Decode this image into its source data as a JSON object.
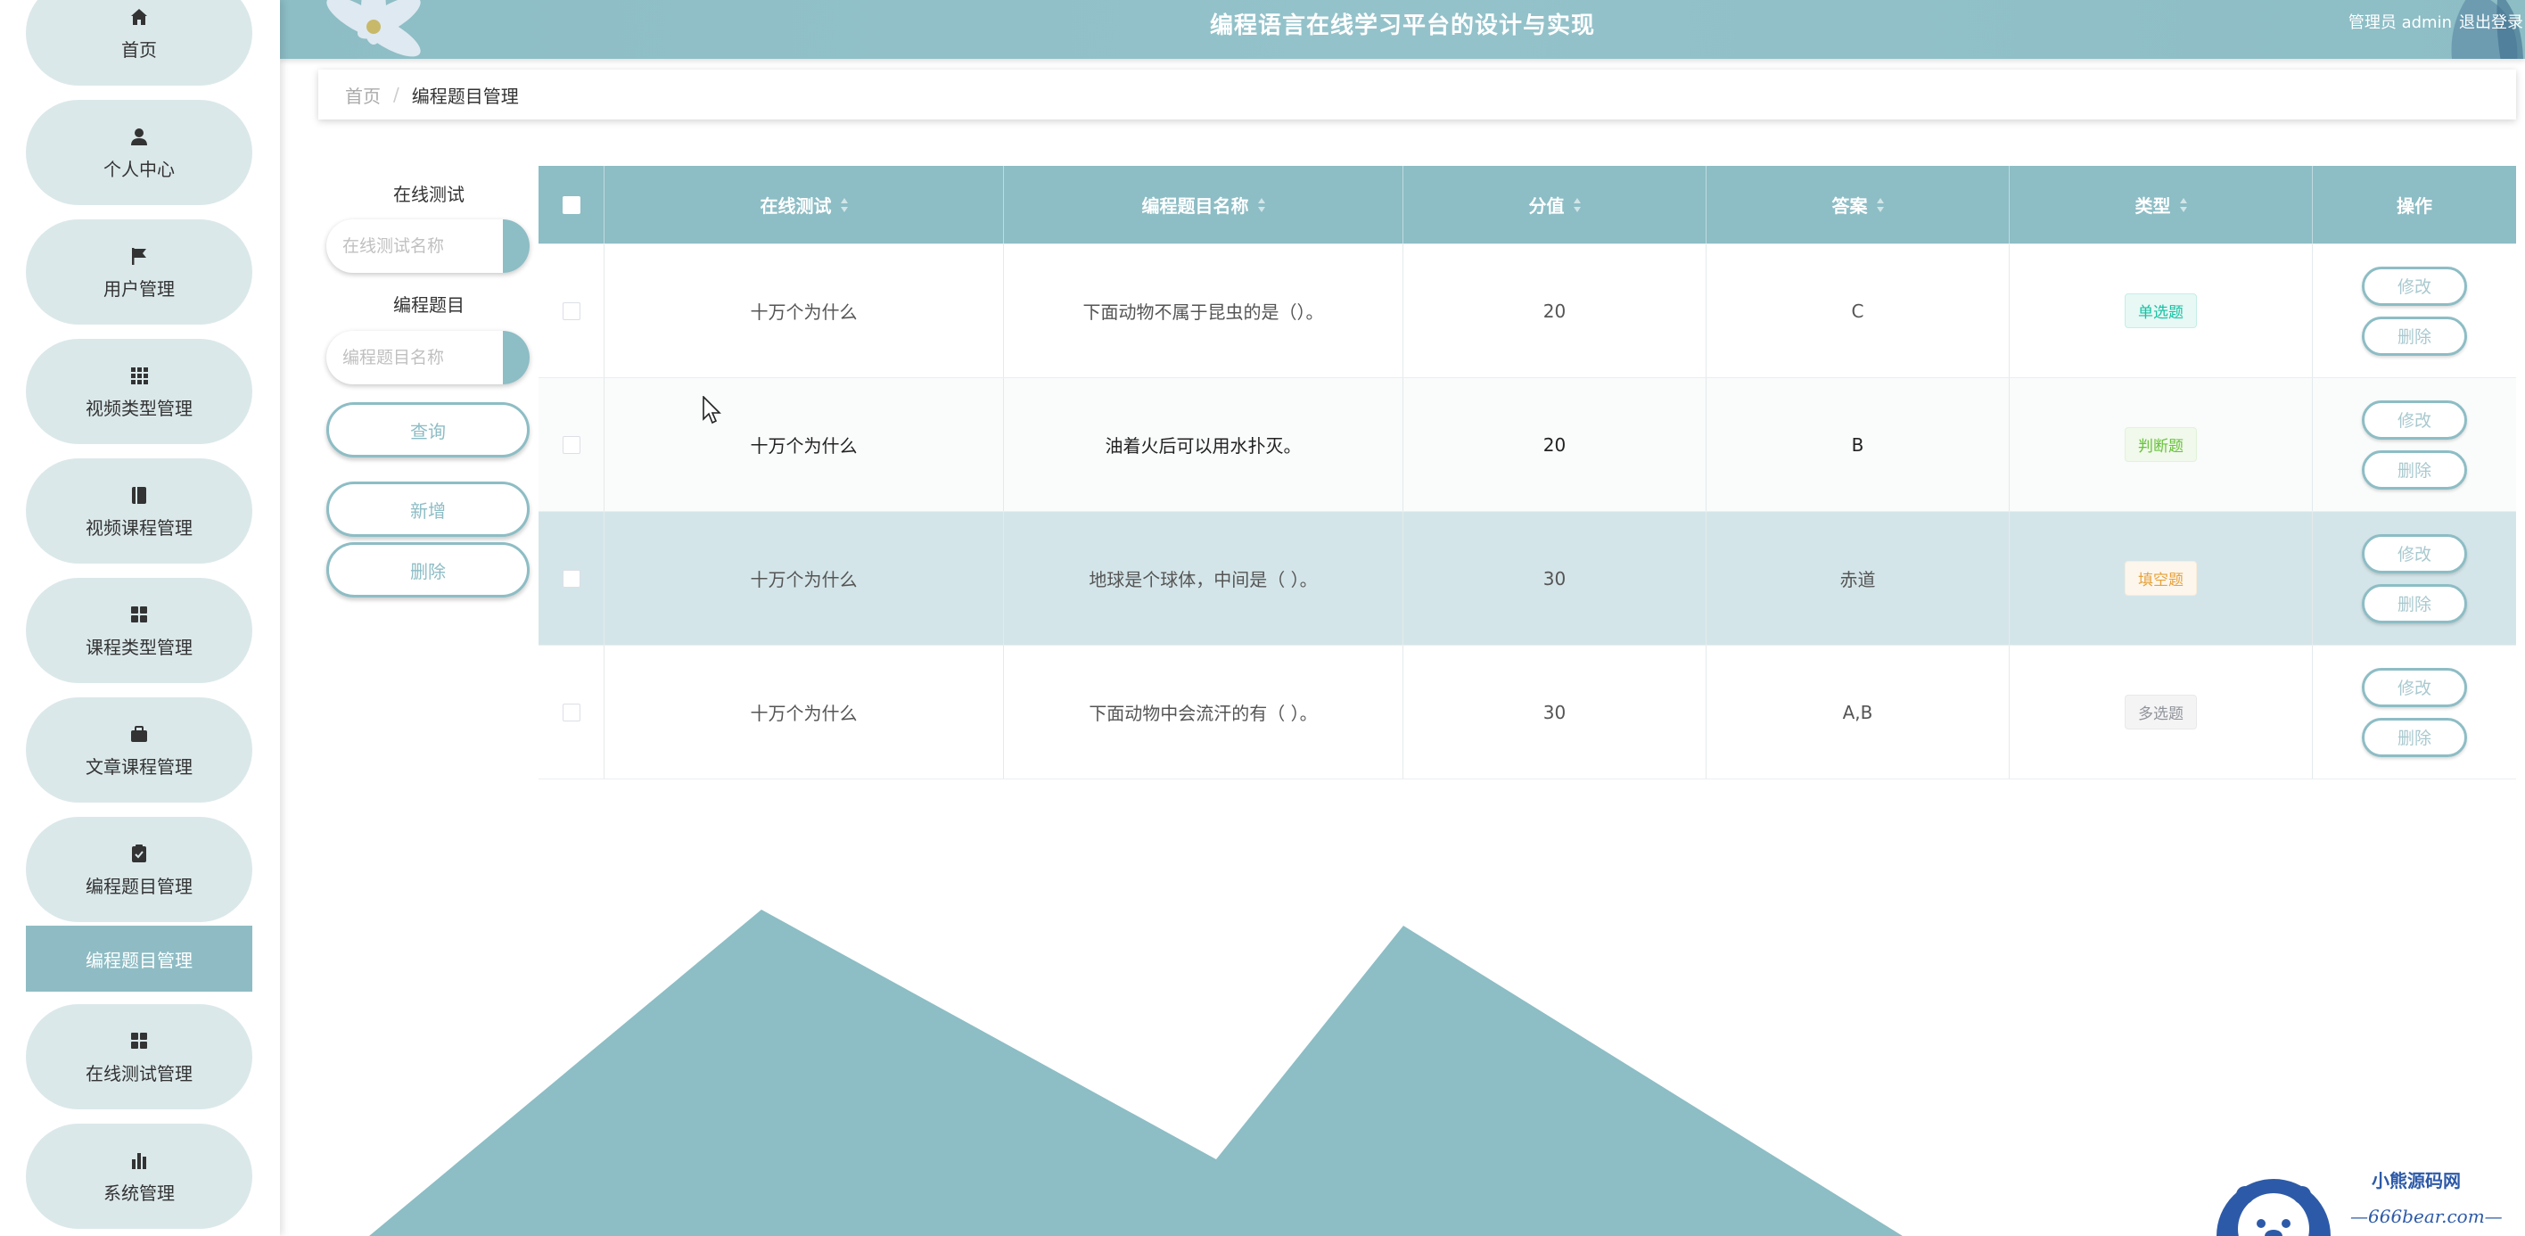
{
  "app": {
    "title": "编程语言在线学习平台的设计与实现",
    "user": "管理员 admin",
    "logout": "退出登录"
  },
  "sidebar": {
    "items": [
      {
        "label": "首页",
        "icon": "home-icon"
      },
      {
        "label": "个人中心",
        "icon": "user-icon"
      },
      {
        "label": "用户管理",
        "icon": "flag-icon"
      },
      {
        "label": "视频类型管理",
        "icon": "grid-icon"
      },
      {
        "label": "视频课程管理",
        "icon": "book-icon"
      },
      {
        "label": "课程类型管理",
        "icon": "grid4-icon"
      },
      {
        "label": "文章课程管理",
        "icon": "briefcase-icon"
      },
      {
        "label": "编程题目管理",
        "icon": "clipboard-icon"
      },
      {
        "label": "在线测试管理",
        "icon": "grid4-icon"
      },
      {
        "label": "系统管理",
        "icon": "bar-chart-icon"
      }
    ],
    "active_sub": "编程题目管理"
  },
  "breadcrumb": {
    "home": "首页",
    "sep": "/",
    "current": "编程题目管理"
  },
  "search": {
    "test_label": "在线测试",
    "test_placeholder": "在线测试名称",
    "question_label": "编程题目",
    "question_placeholder": "编程题目名称",
    "query_btn": "查询",
    "add_btn": "新增",
    "delete_btn": "删除"
  },
  "table": {
    "headers": [
      "在线测试",
      "编程题目名称",
      "分值",
      "答案",
      "类型",
      "操作"
    ],
    "edit_label": "修改",
    "delete_label": "删除",
    "rows": [
      {
        "test": "十万个为什么",
        "name": "下面动物不属于昆虫的是（）。",
        "score": "20",
        "answer": "C",
        "type": "单选题"
      },
      {
        "test": "十万个为什么",
        "name": "油着火后可以用水扑灭。",
        "score": "20",
        "answer": "B",
        "type": "判断题"
      },
      {
        "test": "十万个为什么",
        "name": "地球是个球体，中间是（ ）。",
        "score": "30",
        "answer": "赤道",
        "type": "填空题"
      },
      {
        "test": "十万个为什么",
        "name": "下面动物中会流汗的有（ ）。",
        "score": "30",
        "answer": "A,B",
        "type": "多选题"
      }
    ]
  },
  "tag_colors": {
    "单选题": "#13c2a3",
    "判断题": "#67c23a",
    "填空题": "#e6a23c",
    "多选题": "#909399"
  },
  "watermark": {
    "line1": "小熊源码网",
    "line2": "—666bear.com—"
  },
  "colors": {
    "accent": "#8dbdc5",
    "sidebar_item": "#dbe8ea",
    "row_highlight": "#d4e5e9"
  }
}
